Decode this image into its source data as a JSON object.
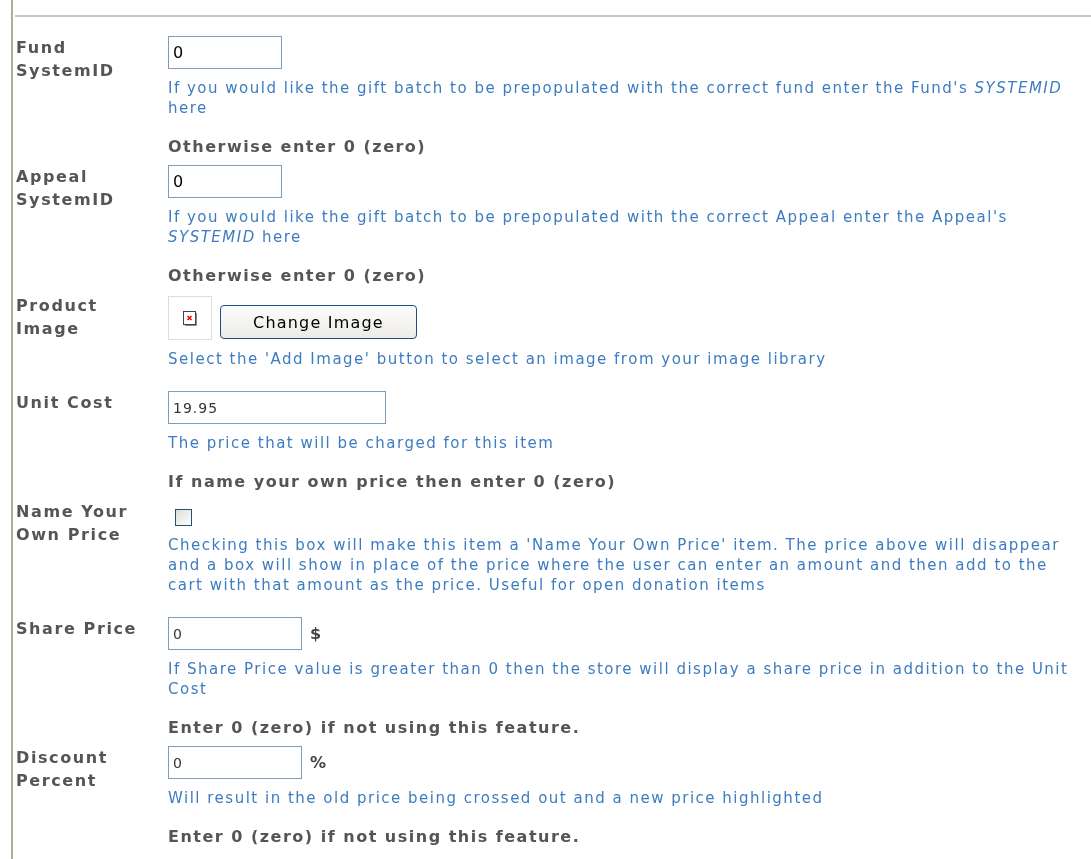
{
  "fields": [
    {
      "kind": "text",
      "label": "Fund SystemID",
      "value": "0",
      "hint": "If you would like the gift batch to be prepopulated with the correct fund enter the Fund's *SYSTEMID* here",
      "note": "Otherwise enter 0 (zero)"
    },
    {
      "kind": "text",
      "label": "Appeal SystemID",
      "value": "0",
      "hint": "If you would like the gift batch to be prepopulated with the correct Appeal enter the Appeal's *SYSTEMID* here",
      "note": "Otherwise enter 0 (zero)"
    },
    {
      "kind": "image",
      "label": "Product Image",
      "button": "Change Image",
      "hint": "Select the 'Add Image' button to select an image from your image library"
    },
    {
      "kind": "text",
      "label": "Unit Cost",
      "value": "19.95",
      "hint": "The price that will be charged for this item",
      "note": "If name your own price then enter 0 (zero)"
    },
    {
      "kind": "checkbox",
      "label": "Name Your Own Price",
      "checked": false,
      "hint": "Checking this box will make this item a 'Name Your Own Price' item. The price above will disappear and a box will show in place of the price where the user can enter an amount and then add to the cart with that amount as the price. Useful for open donation items"
    },
    {
      "kind": "text",
      "label": "Share Price",
      "value": "0",
      "unit": "$",
      "hint": "If Share Price value is greater than 0 then the store will display a share price in addition to the Unit Cost",
      "note": "Enter 0 (zero) if not using this feature."
    },
    {
      "kind": "text",
      "label": "Discount Percent",
      "value": "0",
      "unit": "%",
      "hint": "Will result in the old price being crossed out and a new price highlighted",
      "note": "Enter 0 (zero) if not using this feature."
    }
  ]
}
